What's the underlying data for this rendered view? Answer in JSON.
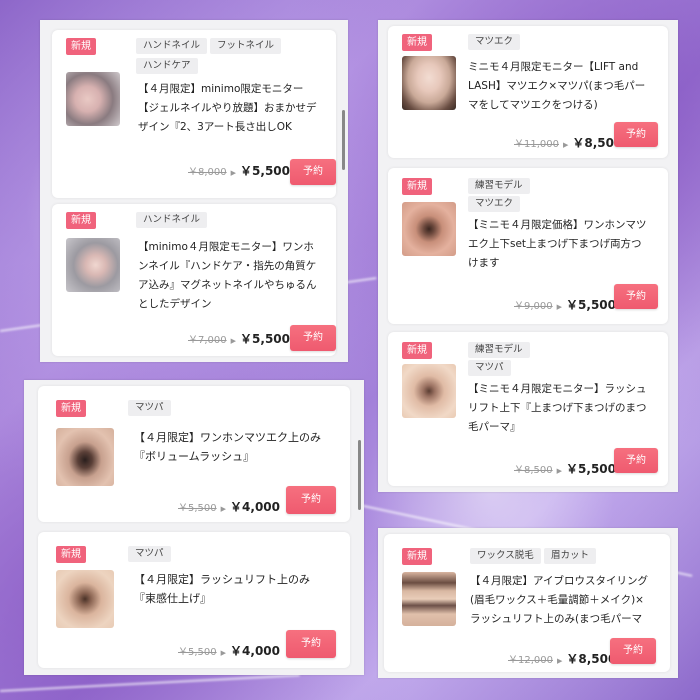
{
  "cards": {
    "c1": {
      "badge": "新規",
      "tags": [
        "ハンドネイル",
        "フットネイル",
        "ハンドケア"
      ],
      "title": [
        "【４月限定】minimo限定モニター",
        "【ジェルネイルやり放題】おまかせデ",
        "ザイン『2、3アート長さ出しOK"
      ],
      "orig_price": "￥8,000",
      "price": "￥5,500",
      "button": "予約"
    },
    "c2": {
      "badge": "新規",
      "tags": [
        "ハンドネイル"
      ],
      "title": [
        "【minimo４月限定モニター】ワンホ",
        "ンネイル『ハンドケア・指先の角質ケ",
        "ア込み』マグネットネイルやちゅるん",
        "としたデザイン"
      ],
      "orig_price": "￥7,000",
      "price": "￥5,500",
      "button": "予約"
    },
    "c3": {
      "badge": "新規",
      "tags": [
        "マツパ"
      ],
      "title": [
        "【４月限定】ワンホンマツエク上のみ",
        "『ボリュームラッシュ』"
      ],
      "orig_price": "￥5,500",
      "price": "￥4,000",
      "button": "予約"
    },
    "c4": {
      "badge": "新規",
      "tags": [
        "マツパ"
      ],
      "title": [
        "【４月限定】ラッシュリフト上のみ",
        "『束感仕上げ』"
      ],
      "orig_price": "￥5,500",
      "price": "￥4,000",
      "button": "予約"
    },
    "c5": {
      "badge": "新規",
      "tags": [
        "マツエク"
      ],
      "title": [
        "ミニモ４月限定モニター【LIFT and",
        "LASH】マツエク×マツパ(まつ毛パー",
        "マをしてマツエクをつける)"
      ],
      "orig_price": "￥11,000",
      "price": "￥8,500",
      "button": "予約"
    },
    "c6": {
      "badge": "新規",
      "tags": [
        "練習モデル",
        "マツエク"
      ],
      "title": [
        "【ミニモ４月限定価格】ワンホンマツ",
        "エク上下set上まつげ下まつげ両方つ",
        "けます"
      ],
      "orig_price": "￥9,000",
      "price": "￥5,500",
      "button": "予約"
    },
    "c7": {
      "badge": "新規",
      "tags": [
        "練習モデル",
        "マツパ"
      ],
      "title": [
        "【ミニモ４月限定モニター】ラッシュ",
        "リフト上下『上まつげ下まつげのまつ",
        "毛パーマ』"
      ],
      "orig_price": "￥8,500",
      "price": "￥5,500",
      "button": "予約"
    },
    "c8": {
      "badge": "新規",
      "tags": [
        "ワックス脱毛",
        "眉カット"
      ],
      "title": [
        "【４月限定】アイブロウスタイリング",
        "(眉毛ワックス＋毛量調節＋メイク)×",
        "ラッシュリフト上のみ(まつ毛パーマ"
      ],
      "orig_price": "￥12,000",
      "price": "￥8,500",
      "button": "予約"
    }
  },
  "colors": {
    "accent": "#f0637c",
    "badge": "#f0637c",
    "text": "#222222"
  }
}
